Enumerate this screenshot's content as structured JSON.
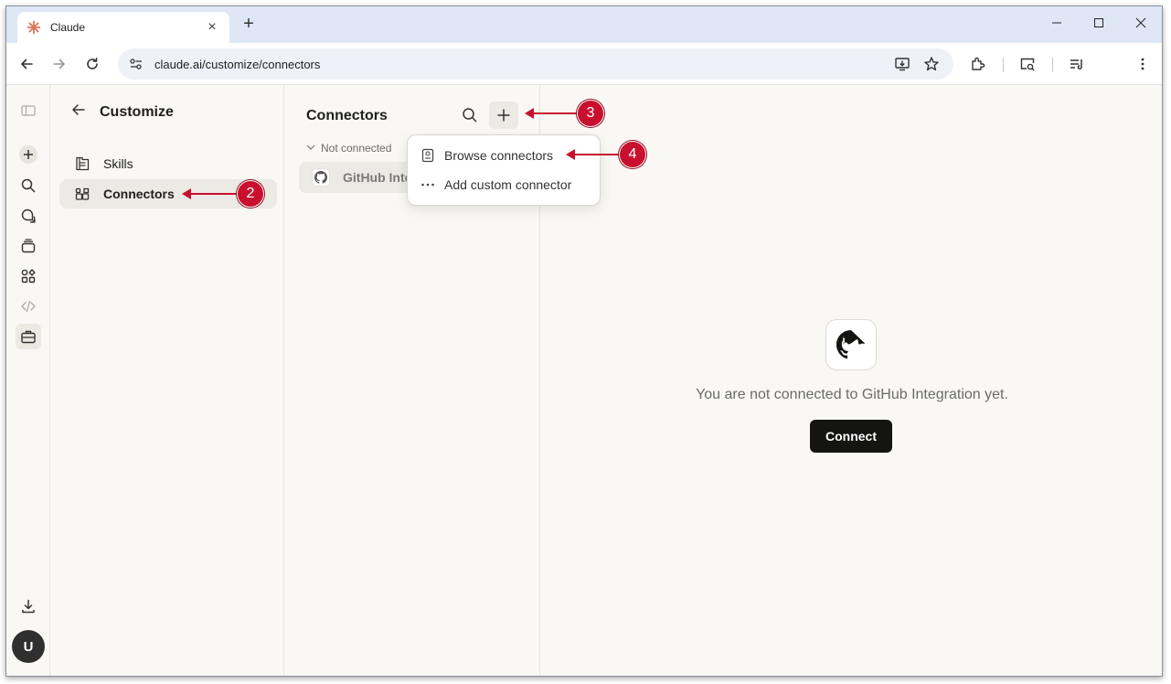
{
  "browser": {
    "tab_title": "Claude",
    "url": "claude.ai/customize/connectors"
  },
  "customize": {
    "title": "Customize",
    "items": [
      {
        "label": "Skills",
        "icon": "skills-icon"
      },
      {
        "label": "Connectors",
        "icon": "connectors-icon"
      }
    ]
  },
  "connectors": {
    "title": "Connectors",
    "section_label": "Not connected",
    "rows": [
      {
        "name": "GitHub Integration",
        "icon": "github-icon"
      }
    ]
  },
  "add_menu": {
    "items": [
      {
        "label": "Browse connectors",
        "icon": "book-icon"
      },
      {
        "label": "Add custom connector",
        "icon": "more-horizontal-icon"
      }
    ]
  },
  "detail": {
    "message": "You are not connected to GitHub Integration yet.",
    "connect_label": "Connect"
  },
  "user": {
    "initial": "U"
  },
  "annotations": [
    "2",
    "3",
    "4"
  ],
  "colors": {
    "accent": "#c8102e",
    "primary_button": "#141413",
    "background": "#f9f8f5"
  }
}
